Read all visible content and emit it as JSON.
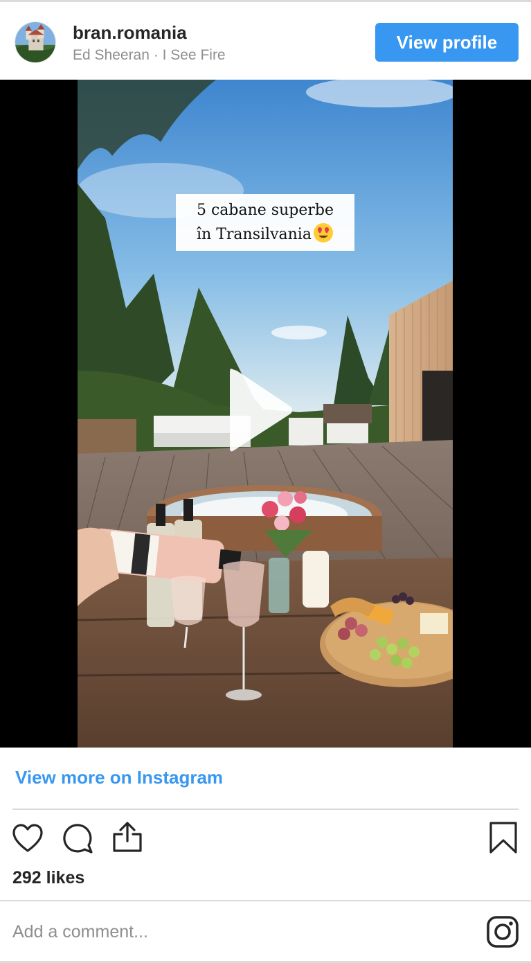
{
  "header": {
    "username": "bran.romania",
    "subtitle": "Ed Sheeran · I See Fire",
    "view_profile_label": "View profile"
  },
  "media": {
    "caption_line1": "5 cabane superbe",
    "caption_line2": "în Transilvania",
    "caption_emoji": "heart-eyes-emoji"
  },
  "footer": {
    "view_more_label": "View more on Instagram",
    "likes": "292 likes",
    "comment_placeholder": "Add a comment..."
  },
  "icons": [
    "heart-icon",
    "comment-icon",
    "share-icon",
    "bookmark-icon",
    "instagram-logo-icon"
  ],
  "colors": {
    "accent": "#3897f0",
    "text": "#262626",
    "muted": "#8e8e8e",
    "divider": "#dbdbdb"
  }
}
